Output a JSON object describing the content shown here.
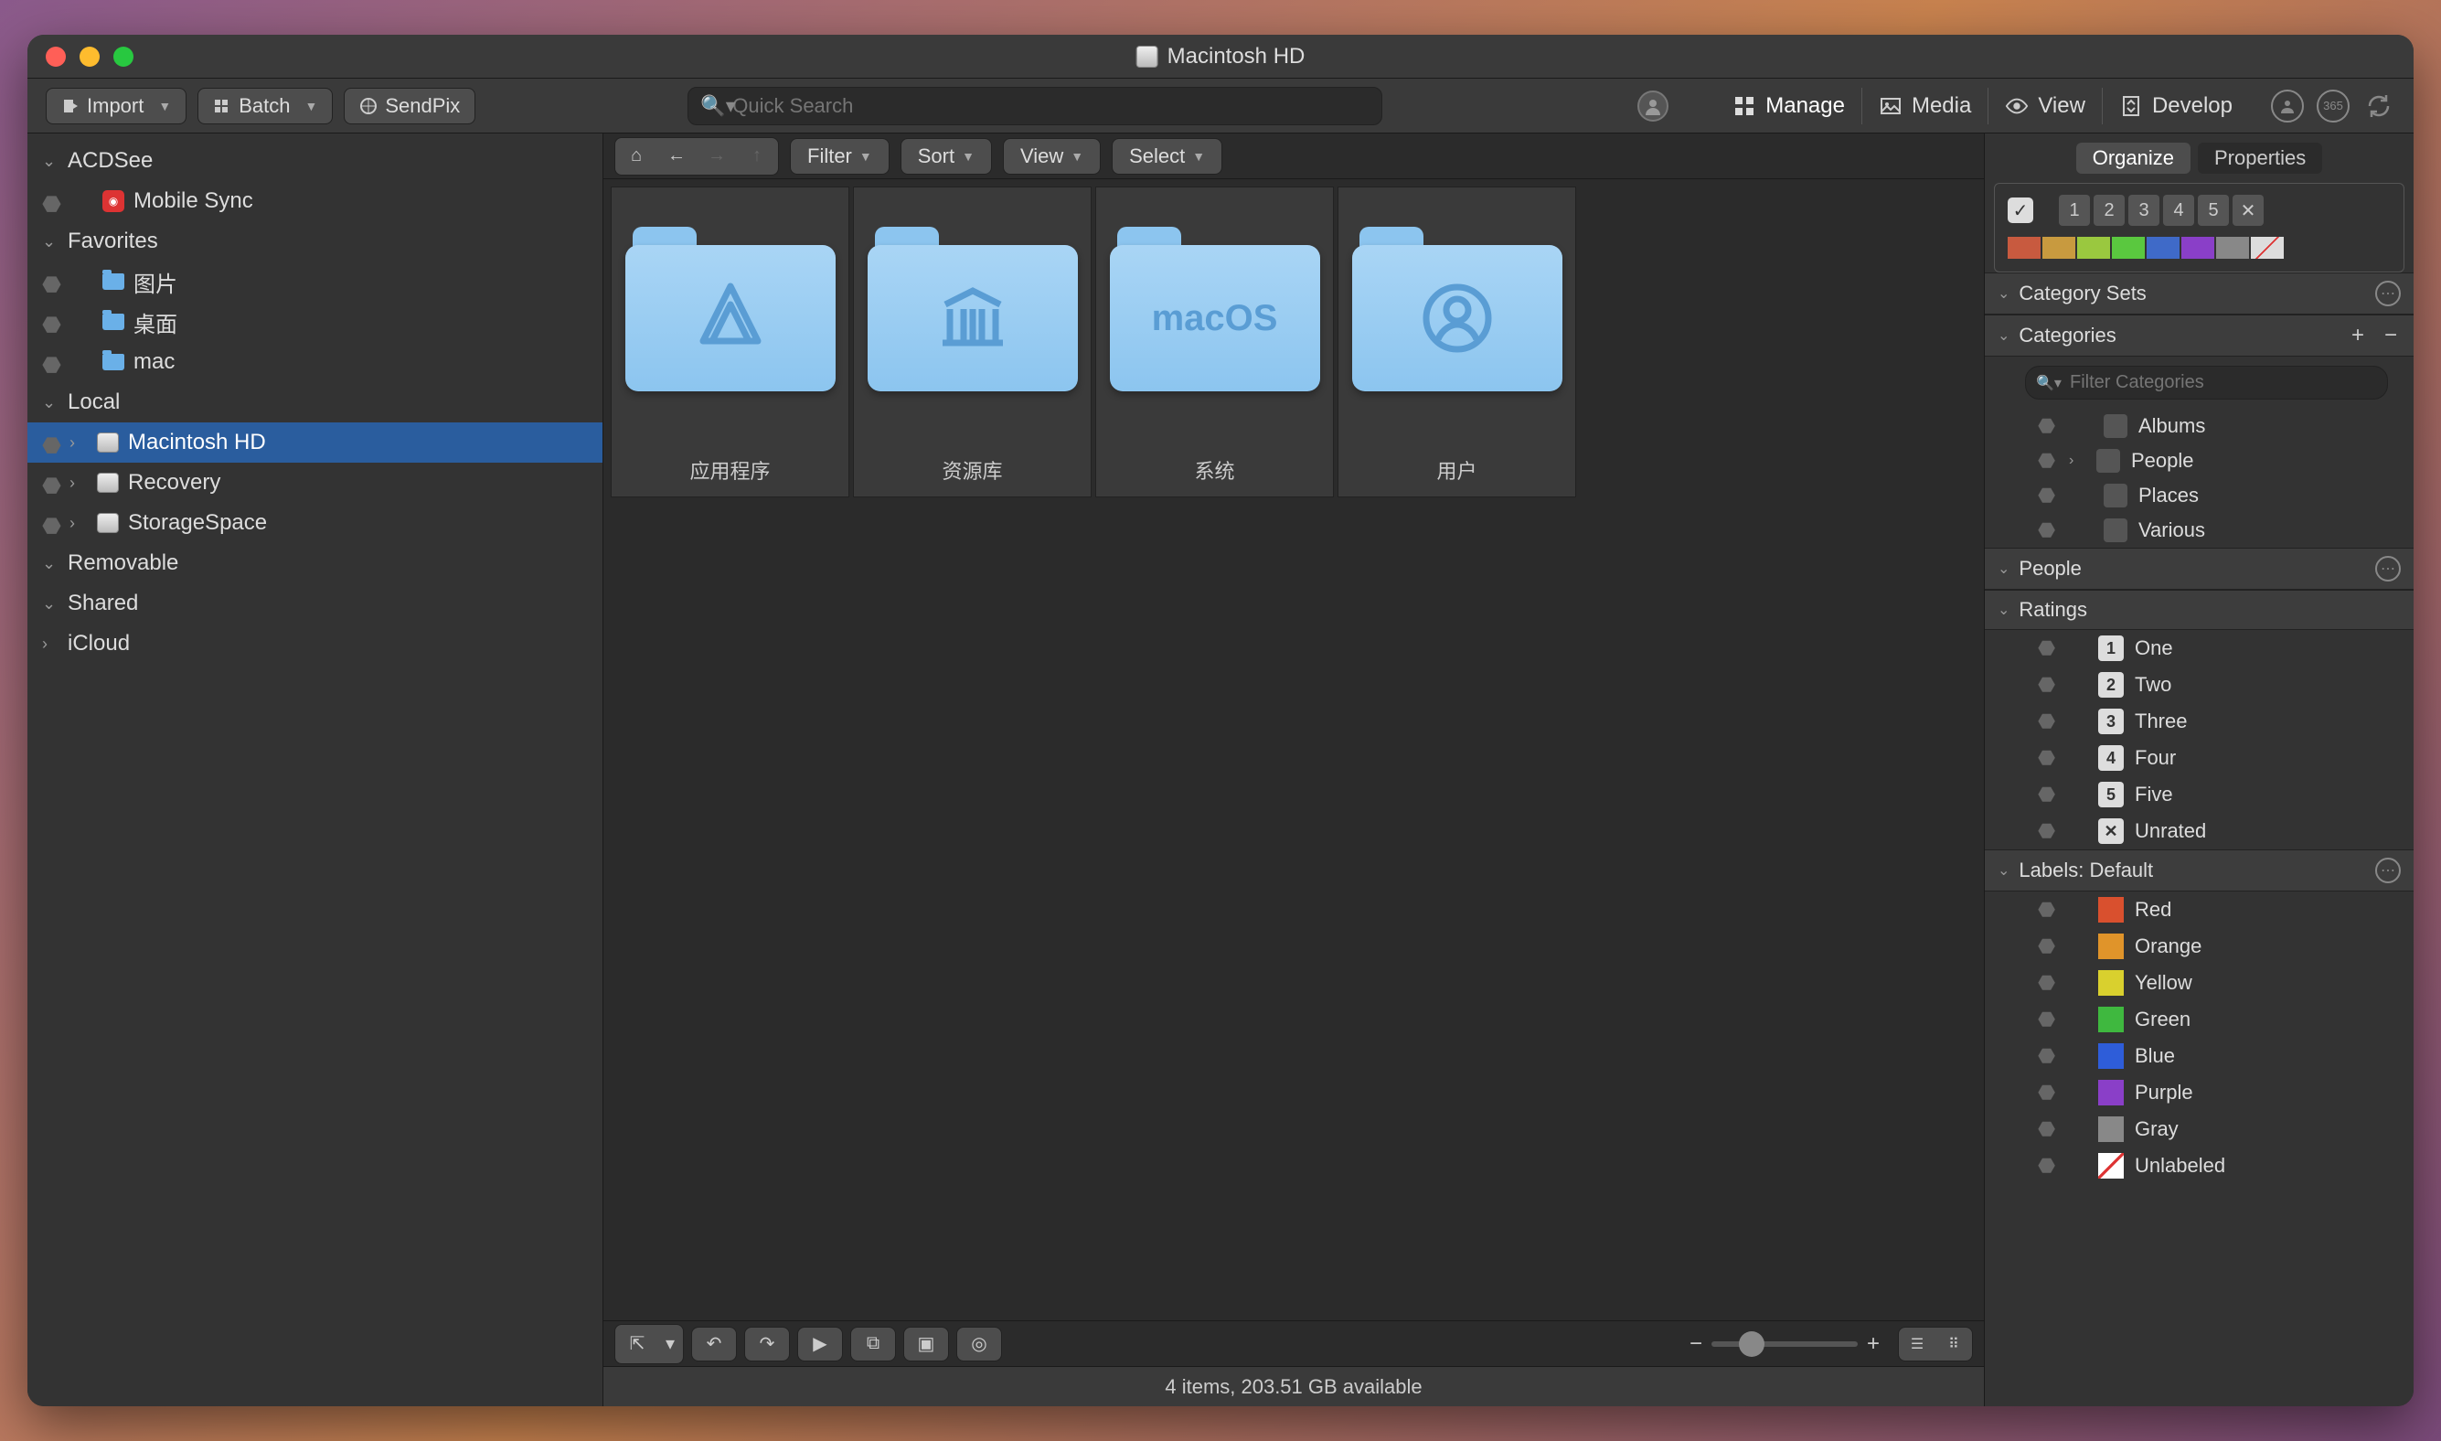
{
  "window": {
    "title": "Macintosh HD"
  },
  "toolbar": {
    "import": "Import",
    "batch": "Batch",
    "sendpix": "SendPix",
    "search_placeholder": "Quick Search",
    "modes": {
      "manage": "Manage",
      "media": "Media",
      "view": "View",
      "develop": "Develop"
    }
  },
  "sidebar": {
    "acdsee": "ACDSee",
    "mobile_sync": "Mobile Sync",
    "favorites": "Favorites",
    "fav_items": [
      "图片",
      "桌面",
      "mac"
    ],
    "local": "Local",
    "local_items": [
      "Macintosh HD",
      "Recovery",
      "StorageSpace"
    ],
    "removable": "Removable",
    "shared": "Shared",
    "icloud": "iCloud"
  },
  "center_toolbar": {
    "filter": "Filter",
    "sort": "Sort",
    "view": "View",
    "select": "Select"
  },
  "folders": [
    {
      "name": "应用程序",
      "glyph": "app"
    },
    {
      "name": "资源库",
      "glyph": "library"
    },
    {
      "name": "系统",
      "glyph": "macos"
    },
    {
      "name": "用户",
      "glyph": "user"
    }
  ],
  "status": "4 items, 203.51 GB available",
  "right": {
    "tabs": {
      "organize": "Organize",
      "properties": "Properties"
    },
    "ratings_hdr": [
      "1",
      "2",
      "3",
      "4",
      "5",
      "✕"
    ],
    "colors_top": [
      "#c85a3f",
      "#c89a3f",
      "#9ac83f",
      "#5ac83f",
      "#3f6ac8",
      "#8a3fc8",
      "#888",
      "#ddd"
    ],
    "category_sets": "Category Sets",
    "categories": "Categories",
    "filter_cat_ph": "Filter Categories",
    "cat_items": [
      "Albums",
      "People",
      "Places",
      "Various"
    ],
    "people_hdr": "People",
    "ratings_section": "Ratings",
    "rating_items": [
      {
        "n": "1",
        "label": "One"
      },
      {
        "n": "2",
        "label": "Two"
      },
      {
        "n": "3",
        "label": "Three"
      },
      {
        "n": "4",
        "label": "Four"
      },
      {
        "n": "5",
        "label": "Five"
      },
      {
        "n": "✕",
        "label": "Unrated"
      }
    ],
    "labels_hdr": "Labels: Default",
    "label_items": [
      {
        "c": "#d9502e",
        "label": "Red"
      },
      {
        "c": "#e0942a",
        "label": "Orange"
      },
      {
        "c": "#d9d02e",
        "label": "Yellow"
      },
      {
        "c": "#3fb83f",
        "label": "Green"
      },
      {
        "c": "#2e5dd9",
        "label": "Blue"
      },
      {
        "c": "#8a3fc8",
        "label": "Purple"
      },
      {
        "c": "#888",
        "label": "Gray"
      },
      {
        "c": "unlabeled",
        "label": "Unlabeled"
      }
    ]
  }
}
